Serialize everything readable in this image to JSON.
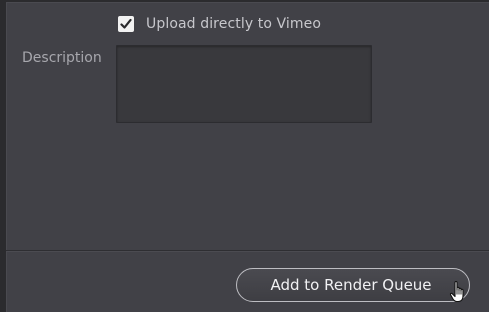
{
  "upload": {
    "checked": true,
    "label": "Upload directly to Vimeo"
  },
  "description": {
    "label": "Description",
    "value": ""
  },
  "actions": {
    "add_to_render_queue_label": "Add to Render Queue"
  },
  "icons": {
    "checkbox": "checkmark-icon",
    "cursor": "hand-pointer-cursor-icon"
  },
  "colors": {
    "panel_bg": "#414147",
    "outer_bg": "#2b2b2e",
    "field_bg": "#39393d",
    "button_border": "#bdbdc2",
    "text": "#c7c7cc"
  }
}
